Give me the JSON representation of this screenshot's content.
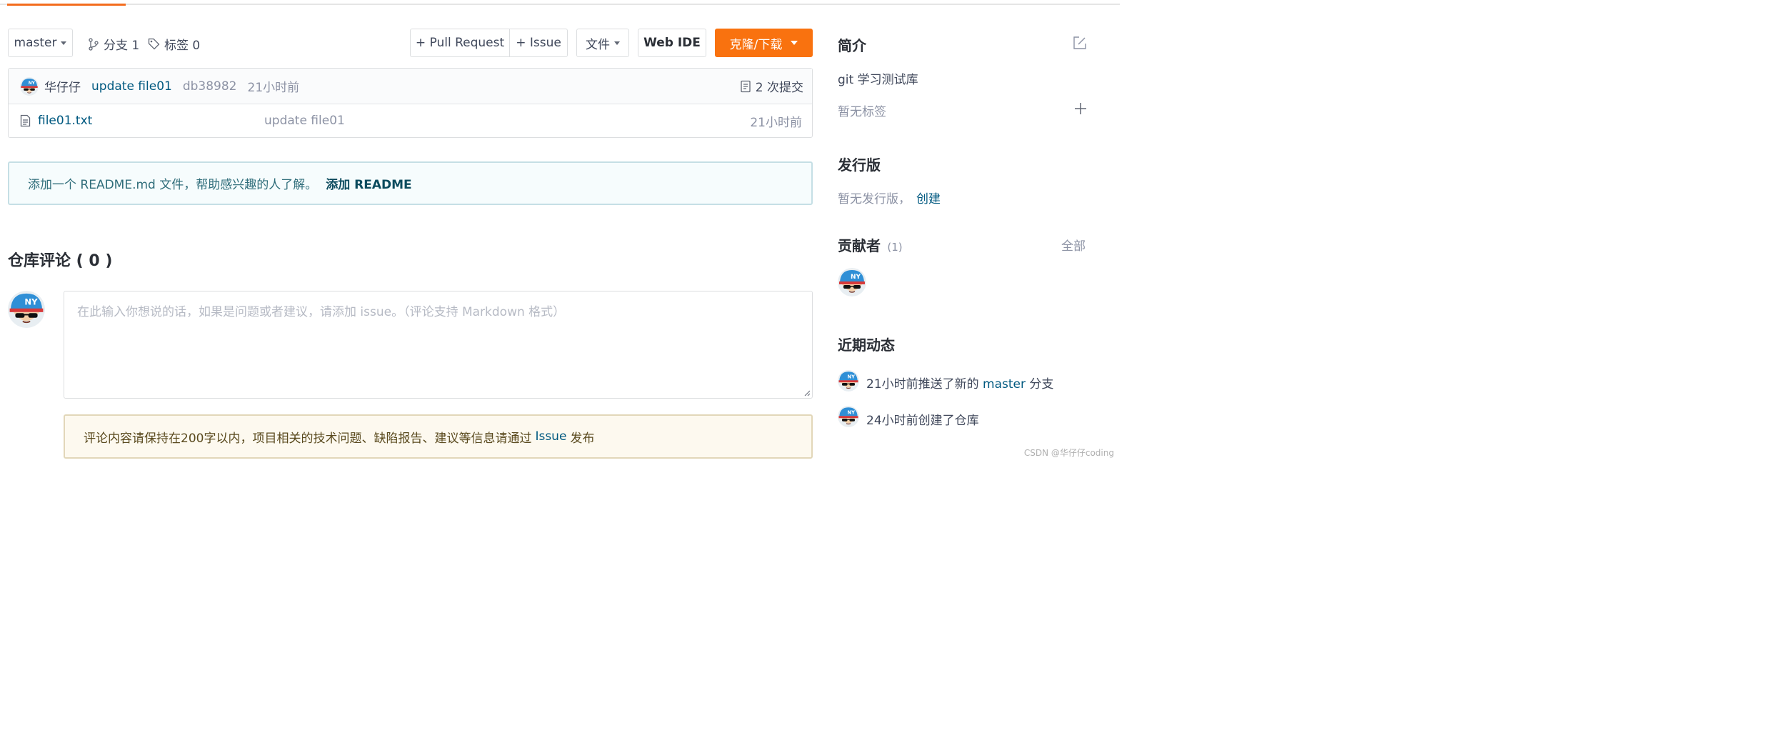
{
  "toolbar": {
    "branch": "master",
    "branches_label": "分支 1",
    "tags_label": "标签 0",
    "pull_request": "+ Pull Request",
    "issue": "+ Issue",
    "files": "文件",
    "web_ide": "Web IDE",
    "clone": "克隆/下载"
  },
  "commit": {
    "author": "华仔仔",
    "message": "update file01",
    "hash": "db38982",
    "time": "21小时前",
    "count": "2 次提交"
  },
  "files": [
    {
      "name": "file01.txt",
      "message": "update file01",
      "time": "21小时前"
    }
  ],
  "readme": {
    "text": "添加一个 README.md 文件，帮助感兴趣的人了解。",
    "link": "添加 README"
  },
  "comments": {
    "title": "仓库评论 ( 0 )",
    "placeholder": "在此输入你想说的话，如果是问题或者建议，请添加 issue。（评论支持 Markdown 格式）",
    "notice_text": "评论内容请保持在200字以内，项目相关的技术问题、缺陷报告、建议等信息请通过",
    "notice_link": "Issue",
    "notice_tail": "发布"
  },
  "sidebar": {
    "intro_title": "简介",
    "description": "git 学习测试库",
    "no_tags": "暂无标签",
    "release_title": "发行版",
    "no_release": "暂无发行版，",
    "create": "创建",
    "contributors_title": "贡献者",
    "contributors_count": "(1)",
    "all": "全部",
    "activity_title": "近期动态",
    "activity": [
      {
        "pre": "21小时前推送了新的",
        "link": "master",
        "post": "分支"
      },
      {
        "pre": "24小时前创建了仓库",
        "link": "",
        "post": ""
      }
    ]
  },
  "watermark": "CSDN @华仔仔coding",
  "colors": {
    "accent": "#f36c1e",
    "link": "#005980",
    "readme_bg": "#f6fcfd",
    "notice_bg": "#fdf9ef"
  }
}
